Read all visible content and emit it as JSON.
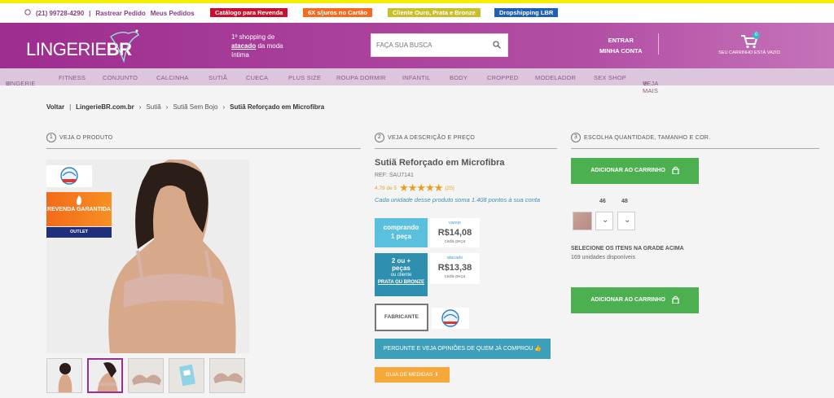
{
  "topbar": {
    "phone": "(21) 99728-4290",
    "links": [
      "Rastrear Pedido",
      "Meus Pedidos"
    ],
    "pills": [
      {
        "label": "Catálogo para Revenda",
        "color": "#c8102e"
      },
      {
        "label": "6X s/juros no Cartão",
        "color": "#f26b21"
      },
      {
        "label": "Cliente Ouro, Prata e Bronze",
        "color": "#c8c02a"
      },
      {
        "label": "Dropshipping LBR",
        "color": "#1f5fb5"
      }
    ]
  },
  "header": {
    "logo_light": "LINGERIE",
    "logo_bold": "BR",
    "tagline_pre": "1º shopping de",
    "tagline_link": "atacado",
    "tagline_post": "da moda íntima",
    "search_placeholder": "FAÇA SUA BUSCA",
    "account_line1": "ENTRAR",
    "account_line2": "MINHA CONTA",
    "cart_label": "SEU CARRINHO ESTÁ VAZIO",
    "cart_count": "0"
  },
  "nav": [
    "LINGERIE",
    "FITNESS",
    "CONJUNTO",
    "CALCINHA",
    "SUTIÃ",
    "CUECA",
    "PLUS SIZE",
    "ROUPA DORMIR",
    "INFANTIL",
    "BODY",
    "CROPPED",
    "MODELADOR",
    "SEX SHOP",
    "VEJA MAIS"
  ],
  "breadcrumb": {
    "back": "Voltar",
    "items": [
      "LingerieBR.com.br",
      "Sutiã",
      "Sutiã Sem Bojo",
      "Sutiã Reforçado em Microfibra"
    ]
  },
  "steps": [
    {
      "num": "1",
      "label": "VEJA O PRODUTO"
    },
    {
      "num": "2",
      "label": "VEJA A DESCRIÇÃO E PREÇO"
    },
    {
      "num": "3",
      "label": "ESCOLHA QUANTIDADE, TAMANHO E COR."
    }
  ],
  "badges": {
    "revenda": "REVENDA GARANTIDA",
    "outlet": "OUTLET"
  },
  "product": {
    "title": "Sutiã Reforçado em Microfibra",
    "ref": "REF: SAU7141",
    "rating_text": "4.79 de 5",
    "stars": "★★★★★",
    "reviews": "(25)",
    "points": "Cada unidade desse produto soma 1.408 pontos à sua conta"
  },
  "pricing": {
    "varejo": {
      "left_line1": "comprando",
      "left_line2": "1 peça",
      "label": "varejo",
      "price": "R$14,08",
      "unit": "cada peça"
    },
    "atacado": {
      "left_line1": "2 ou +",
      "left_line2": "peças",
      "left_line3": "ou cliente",
      "left_link": "PRATA OU BRONZE",
      "label": "atacado",
      "price": "R$13,38",
      "unit": "cada peça"
    }
  },
  "fabricante": "FABRICANTE",
  "buttons": {
    "ask": "PERGUNTE E VEJA OPINIÕES DE QUEM JÁ COMPROU",
    "medidas": "GUIA DE MEDIDAS",
    "add_cart": "ADICIONAR AO CARRINHO"
  },
  "sizes": [
    "46",
    "48"
  ],
  "grid_note": "SELECIONE OS ITENS NA GRADE ACIMA",
  "units_available": "169 unidades disponíveis",
  "colors": {
    "brand": "#9d2d8f",
    "nav_bg": "#dcc6dd",
    "price_blue": "#5bc0de",
    "add_green": "#4caf50"
  }
}
